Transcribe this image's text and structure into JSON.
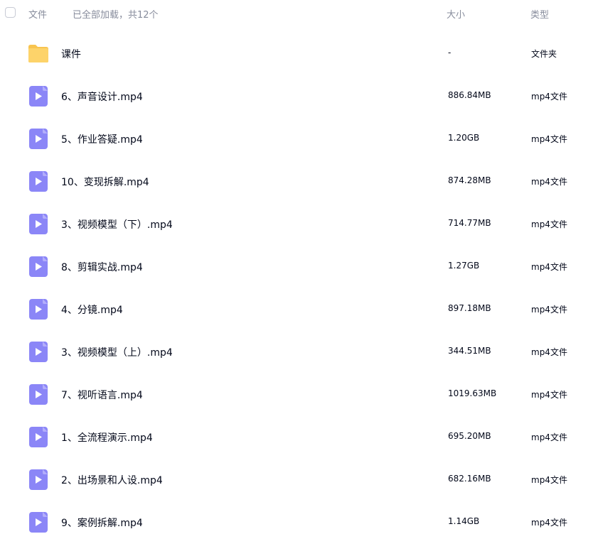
{
  "header": {
    "name_label": "文件",
    "load_status": "已全部加载，共12个",
    "size_label": "大小",
    "type_label": "类型"
  },
  "colors": {
    "folder": "#fdd36a",
    "video_icon": "#8b86f7",
    "text_primary": "#03081a",
    "text_secondary": "#878c9c"
  },
  "files": [
    {
      "name": "课件",
      "size": "-",
      "type": "文件夹",
      "icon": "folder-icon"
    },
    {
      "name": "6、声音设计.mp4",
      "size": "886.84MB",
      "type": "mp4文件",
      "icon": "video-file-icon"
    },
    {
      "name": "5、作业答疑.mp4",
      "size": "1.20GB",
      "type": "mp4文件",
      "icon": "video-file-icon"
    },
    {
      "name": "10、变现拆解.mp4",
      "size": "874.28MB",
      "type": "mp4文件",
      "icon": "video-file-icon"
    },
    {
      "name": "3、视频模型（下）.mp4",
      "size": "714.77MB",
      "type": "mp4文件",
      "icon": "video-file-icon"
    },
    {
      "name": "8、剪辑实战.mp4",
      "size": "1.27GB",
      "type": "mp4文件",
      "icon": "video-file-icon"
    },
    {
      "name": "4、分镜.mp4",
      "size": "897.18MB",
      "type": "mp4文件",
      "icon": "video-file-icon"
    },
    {
      "name": "3、视频模型（上）.mp4",
      "size": "344.51MB",
      "type": "mp4文件",
      "icon": "video-file-icon"
    },
    {
      "name": "7、视听语言.mp4",
      "size": "1019.63MB",
      "type": "mp4文件",
      "icon": "video-file-icon"
    },
    {
      "name": "1、全流程演示.mp4",
      "size": "695.20MB",
      "type": "mp4文件",
      "icon": "video-file-icon"
    },
    {
      "name": "2、出场景和人设.mp4",
      "size": "682.16MB",
      "type": "mp4文件",
      "icon": "video-file-icon"
    },
    {
      "name": "9、案例拆解.mp4",
      "size": "1.14GB",
      "type": "mp4文件",
      "icon": "video-file-icon"
    }
  ]
}
